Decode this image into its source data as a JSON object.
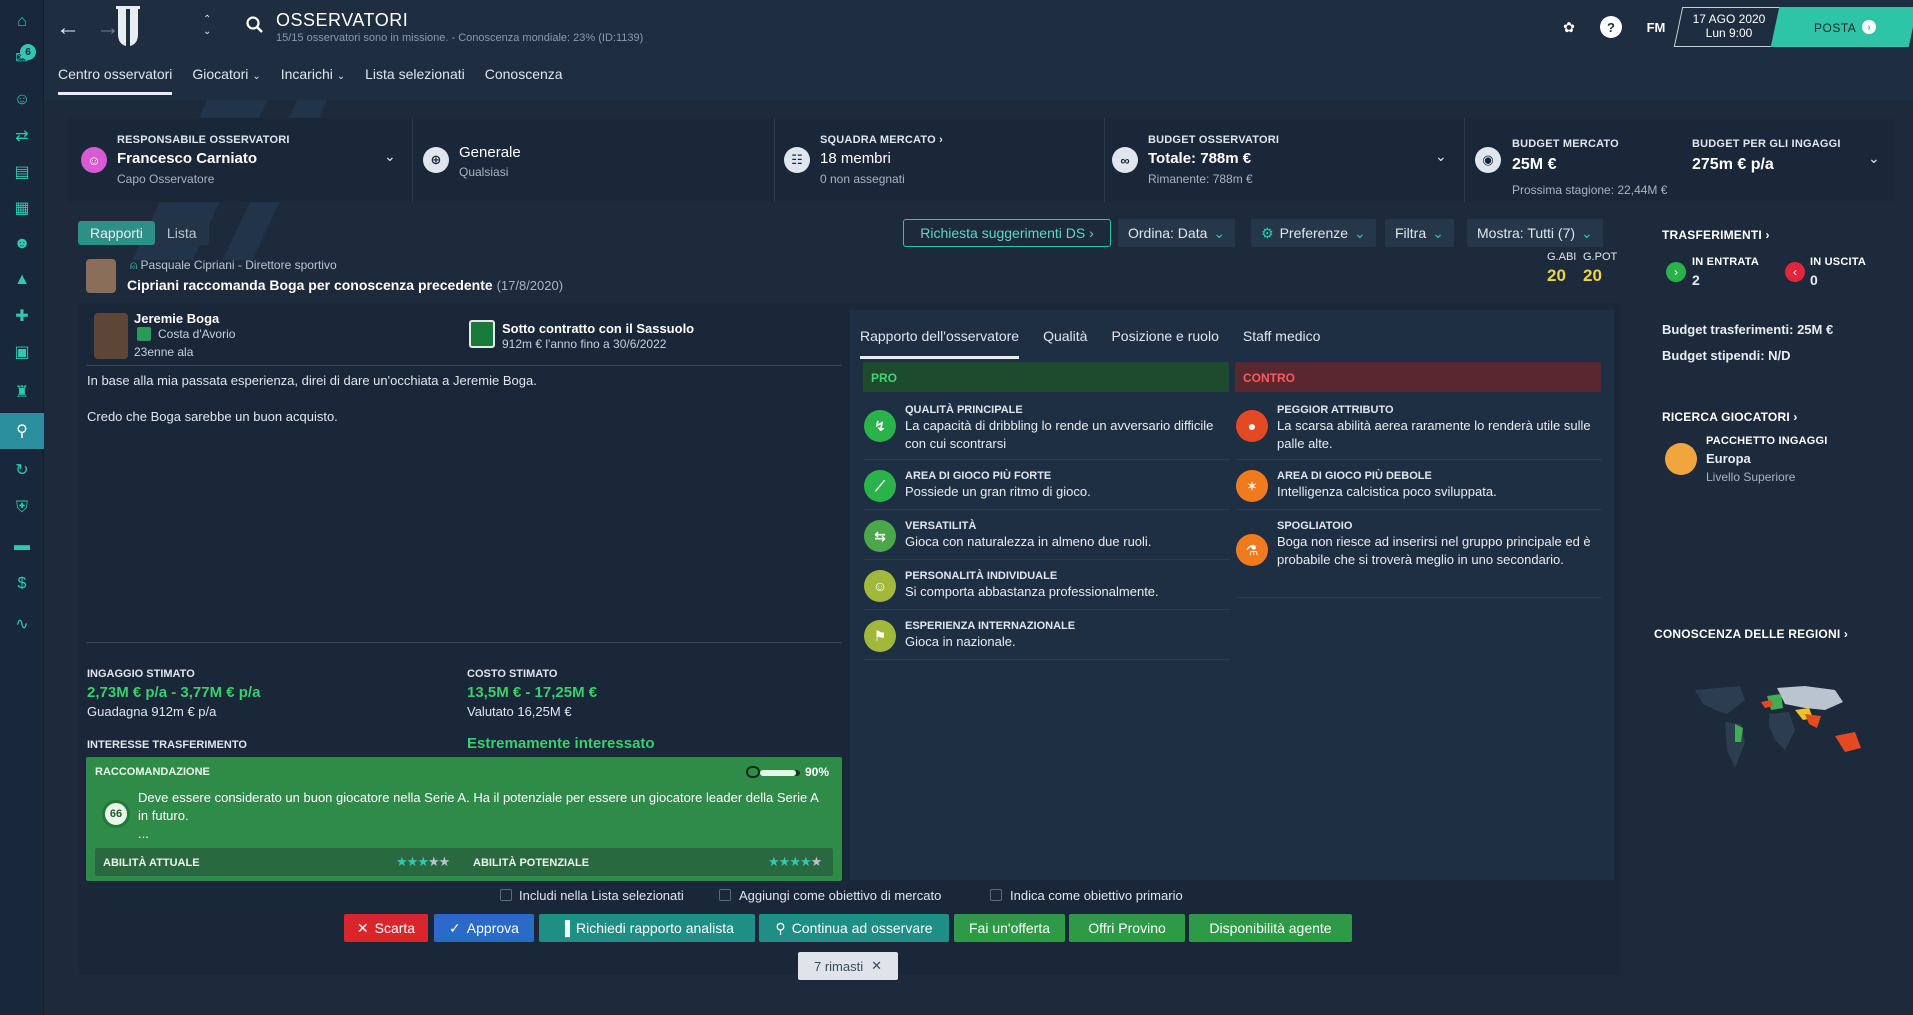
{
  "header": {
    "title": "OSSERVATORI",
    "subtitle": "15/15 osservatori sono in missione. - Conoscenza mondiale: 23% (ID:1139)",
    "fm_label": "FM",
    "date": "17 AGO 2020",
    "time": "Lun 9:00",
    "posta": "POSTA",
    "notif_count": "6",
    "tabs": [
      "Centro osservatori",
      "Giocatori",
      "Incarichi",
      "Lista selezionati",
      "Conoscenza"
    ]
  },
  "summary": {
    "chief_label": "RESPONSABILE OSSERVATORI",
    "chief_name": "Francesco Carniato",
    "chief_role": "Capo Osservatore",
    "generale": "Generale",
    "generale_sub": "Qualsiasi",
    "squad_label": "SQUADRA MERCATO",
    "squad_val": "18 membri",
    "squad_sub": "0 non assegnati",
    "budget_label": "BUDGET OSSERVATORI",
    "budget_val": "Totale: 788m €",
    "budget_sub": "Rimanente: 788m €",
    "market_label": "BUDGET MERCATO",
    "market_val": "25M €",
    "market_sub": "Prossima stagione: 22,44M €",
    "wage_label": "BUDGET PER GLI INGAGGI",
    "wage_val": "275m € p/a"
  },
  "toolbar": {
    "tab_rapporti": "Rapporti",
    "tab_lista": "Lista",
    "request": "Richiesta suggerimenti DS",
    "ordina": "Ordina: Data",
    "preferenze": "Preferenze",
    "filtra": "Filtra",
    "mostra": "Mostra: Tutti (7)"
  },
  "report": {
    "author": "Pasquale Cipriani - Direttore sportivo",
    "headline": "Cipriani raccomanda Boga per conoscenza precedente",
    "date": "(17/8/2020)",
    "gabi_label": "G.ABI",
    "gabi": "20",
    "gpot_label": "G.POT",
    "gpot": "20",
    "player_name": "Jeremie Boga",
    "player_nation": "Costa d'Avorio",
    "player_age": "23enne ala",
    "contract_title": "Sotto contratto con il Sassuolo",
    "contract_sub": "912m € l'anno fino a 30/6/2022",
    "text1": "In base alla mia passata esperienza, direi di dare un'occhiata a Jeremie Boga.",
    "text2": "Credo che Boga sarebbe un buon acquisto.",
    "wage_label": "INGAGGIO STIMATO",
    "wage_val": "2,73M € p/a - 3,77M € p/a",
    "wage_sub": "Guadagna 912m € p/a",
    "cost_label": "COSTO STIMATO",
    "cost_val": "13,5M € - 17,25M €",
    "cost_sub": "Valutato 16,25M €",
    "interest_label": "INTERESSE TRASFERIMENTO",
    "interest_val": "Estremamente interessato",
    "reco_label": "RACCOMANDAZIONE",
    "reco_pct": "90%",
    "reco_score": "66",
    "reco_text": "Deve essere considerato un buon giocatore nella Serie A. Ha il potenziale per essere un giocatore leader della Serie A in futuro.",
    "reco_ellipsis": "...",
    "abil_cur_label": "ABILITÀ ATTUALE",
    "abil_pot_label": "ABILITÀ POTENZIALE",
    "abil_cur_stars": 2.5,
    "abil_pot_stars": 3.5
  },
  "detail": {
    "tabs": [
      "Rapporto dell'osservatore",
      "Qualità",
      "Posizione e ruolo",
      "Staff medico"
    ],
    "pro_label": "PRO",
    "contro_label": "CONTRO",
    "pro": [
      {
        "title": "QUALITÀ PRINCIPALE",
        "text": "La capacità di dribbling lo rende un avversario difficile con cui scontrarsi"
      },
      {
        "title": "AREA DI GIOCO PIÙ FORTE",
        "text": "Possiede un gran ritmo di gioco."
      },
      {
        "title": "VERSATILITÀ",
        "text": "Gioca con naturalezza in almeno due ruoli."
      },
      {
        "title": "PERSONALITÀ INDIVIDUALE",
        "text": "Si comporta abbastanza professionalmente."
      },
      {
        "title": "ESPERIENZA INTERNAZIONALE",
        "text": "Gioca in nazionale."
      }
    ],
    "contro": [
      {
        "title": "PEGGIOR ATTRIBUTO",
        "text": "La scarsa abilità aerea raramente lo renderà utile sulle palle alte."
      },
      {
        "title": "AREA DI GIOCO PIÙ DEBOLE",
        "text": "Intelligenza calcistica poco sviluppata."
      },
      {
        "title": "SPOGLIATOIO",
        "text": "Boga non riesce ad inserirsi nel gruppo principale ed è probabile che si troverà meglio in uno secondario."
      }
    ]
  },
  "sidebar": {
    "transfers": "TRASFERIMENTI",
    "in_label": "IN ENTRATA",
    "in_val": "2",
    "out_label": "IN USCITA",
    "out_val": "0",
    "budget_trans": "Budget trasferimenti: 25M €",
    "budget_wage": "Budget stipendi: N/D",
    "search": "RICERCA GIOCATORI",
    "package": "PACCHETTO INGAGGI",
    "package_val": "Europa",
    "package_sub": "Livello Superiore",
    "regions": "CONOSCENZA DELLE REGIONI"
  },
  "actions": {
    "cb1": "Includi nella Lista selezionati",
    "cb2": "Aggiungi come obiettivo di mercato",
    "cb3": "Indica come obiettivo primario",
    "scarta": "Scarta",
    "approva": "Approva",
    "analista": "Richiedi rapporto analista",
    "continua": "Continua ad osservare",
    "offerta": "Fai un'offerta",
    "provino": "Offri Provino",
    "agente": "Disponibilità agente",
    "remaining": "7 rimasti"
  },
  "colors": {
    "accent": "#2ec4a8",
    "positive": "#39d06b",
    "pro_green": "#2e8c48",
    "contro_red": "#e0263a"
  }
}
